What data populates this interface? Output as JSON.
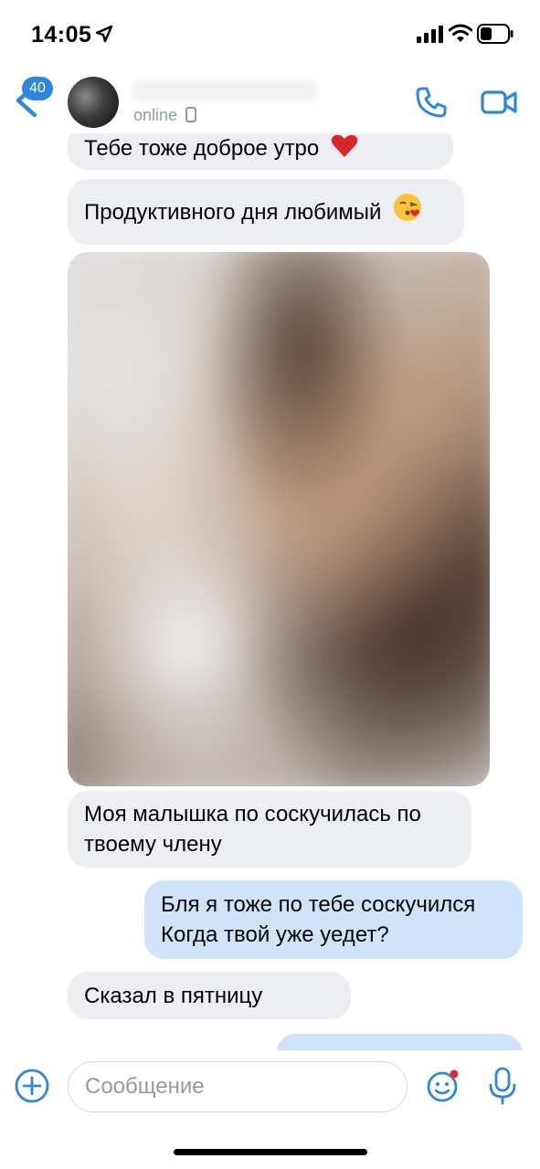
{
  "status_bar": {
    "time": "14:05"
  },
  "header": {
    "unread_badge": "40",
    "contact_status": "online"
  },
  "messages": [
    {
      "side": "in",
      "text": "Тебе тоже доброе утро",
      "emoji": "heart"
    },
    {
      "side": "in",
      "text": "Продуктивного дня любимый",
      "emoji": "kiss-face"
    },
    {
      "side": "in",
      "type": "photo"
    },
    {
      "side": "in",
      "lines": [
        "Моя малышка по соскучилась по",
        "твоему члену"
      ]
    },
    {
      "side": "out",
      "lines": [
        "Бля я тоже по тебе соскучился",
        "Когда твой уже уедет?"
      ]
    },
    {
      "side": "in",
      "text": "Сказал в пятницу"
    }
  ],
  "composer": {
    "placeholder": "Сообщение"
  },
  "colors": {
    "accent": "#2f86dc",
    "incoming_bubble": "#eceef1",
    "outgoing_bubble": "#cfe4fa"
  }
}
